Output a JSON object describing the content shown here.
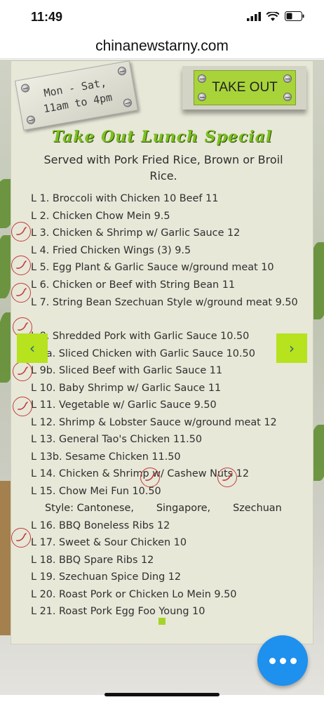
{
  "status_bar": {
    "time": "11:49"
  },
  "browser": {
    "url": "chinanewstarny.com"
  },
  "hours": {
    "line1": "Mon - Sat,",
    "line2": "11am to 4pm"
  },
  "takeout": {
    "label": "TAKE OUT"
  },
  "menu": {
    "title": "Take Out Lunch Special",
    "served_with": "Served with Pork Fried Rice, Brown or Broil Rice.",
    "items": [
      "L 1.  Broccoli with Chicken 10    Beef  11",
      "L 2.  Chicken Chow Mein    9.5",
      "L 3.  Chicken & Shrimp w/ Garlic Sauce  12",
      "L 4.  Fried Chicken Wings (3)      9.5",
      "L 5.  Egg Plant & Garlic Sauce w/ground meat  10",
      "L 6.  Chicken or Beef with String Bean  11",
      "L 7.  String Bean Szechuan Style w/ground meat 9.50",
      "L 8.  Shredded Pork with Garlic Sauce   10.50",
      "L 9a.  Sliced Chicken with Garlic Sauce  10.50",
      "L 9b. Sliced Beef with Garlic Sauce 11",
      "L 10. Baby Shrimp w/ Garlic Sauce    11",
      "L 11.  Vegetable w/ Garlic Sauce     9.50",
      "L 12. Shrimp & Lobster Sauce w/ground meat  12",
      "L 13. General Tao's Chicken    11.50",
      "L 13b. Sesame Chicken    11.50",
      "L 14.  Chicken & Shrimp w/ Cashew Nuts  12",
      "L 15.  Chow Mei Fun  10.50"
    ],
    "style_line": "Style: Cantonese,       Singapore,       Szechuan",
    "items_after": [
      "L 16. BBQ Boneless Ribs  12",
      "L 17. Sweet & Sour Chicken  10",
      "L 18. BBQ Spare Ribs    12",
      "L 19. Szechuan Spice Ding    12",
      "L 20. Roast Pork or Chicken Lo Mein    9.50",
      "L 21.  Roast Pork Egg Foo Young   10"
    ]
  },
  "icons": {
    "prev": "chevron-left-icon",
    "next": "chevron-right-icon",
    "more": "more-dots-icon",
    "spicy": "chili-pepper-icon"
  },
  "colors": {
    "accent_green": "#b6e21e",
    "fab_blue": "#1e90ee",
    "title_green": "#7cc020",
    "chili_red": "#c43d3d"
  }
}
